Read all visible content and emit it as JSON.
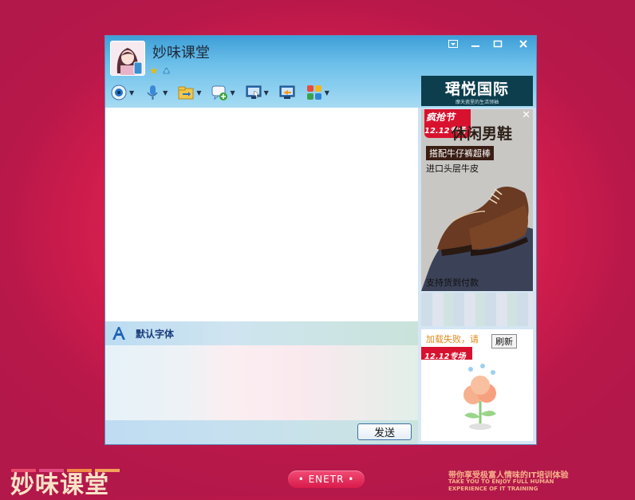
{
  "window": {
    "title": "妙味课堂",
    "controls": [
      "dropdown-icon",
      "minimize-icon",
      "maximize-icon",
      "close-icon"
    ]
  },
  "toolbar": {
    "items": [
      "webcam-icon",
      "microphone-icon",
      "file-transfer-icon",
      "message-add-icon",
      "remote-desktop-icon",
      "screen-share-icon",
      "apps-icon"
    ]
  },
  "format_bar": {
    "font_label": "默认字体"
  },
  "send_button": {
    "label": "发送"
  },
  "ads": {
    "top_banner": {
      "title": "珺悦国际",
      "subtitle": "摩天瓷里的生活领袖"
    },
    "shoe_ad": {
      "badge_line1": "疯抢节",
      "badge_line2": "12.12专场",
      "headline": "休闲男鞋",
      "tag": "搭配牛仔裤超棒",
      "line2": "进口头层牛皮",
      "bottom": "支持货到付款"
    },
    "failed_ad": {
      "message": "加载失败，请",
      "refresh_label": "刷新",
      "badge": "12.12专场"
    }
  },
  "page": {
    "logo": "妙味课堂",
    "enter_button": "• ENETR •",
    "slogan_cn": "带你享受极富人情味的IT培训体验",
    "slogan_en_1": "TAKE YOU TO ENJOY FULL HUMAN",
    "slogan_en_2": "EXPERIENCE OF IT TRAINING"
  },
  "colors": {
    "background": "#d41f4e",
    "titlebar": "#4aa8dd",
    "logo_bars": [
      "#e94a6b",
      "#e34a82",
      "#f08a45",
      "#f4a15c"
    ]
  }
}
